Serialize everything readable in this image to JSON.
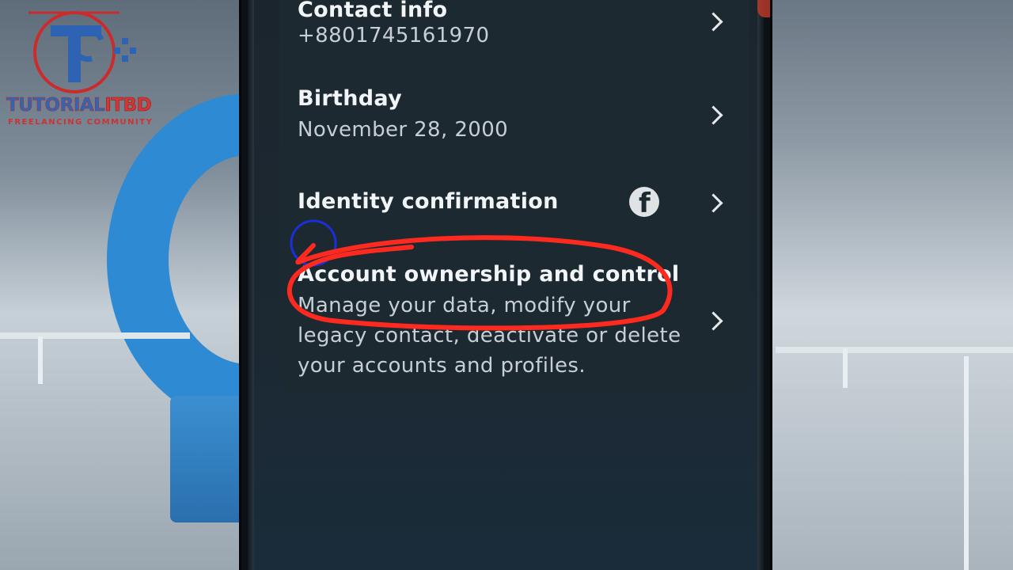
{
  "logo": {
    "word_main": "TUTORIAL",
    "word_accent": "ITBD",
    "tagline": "FREELANCING COMMUNITY"
  },
  "settings": {
    "rows": [
      {
        "title": "Contact info",
        "subtitle": "+8801745161970"
      },
      {
        "title": "Birthday",
        "subtitle": "November 28, 2000"
      },
      {
        "title": "Identity confirmation",
        "icon": "facebook-icon"
      },
      {
        "title": "Account ownership and control",
        "subtitle_lines": [
          "Manage your data, modify your",
          "legacy contact, deactivate or delete",
          "your accounts and profiles."
        ]
      }
    ]
  },
  "colors": {
    "card": "#1d2930",
    "highlight_red": "#ff2a1f",
    "highlight_blue": "#1a2fd6"
  }
}
